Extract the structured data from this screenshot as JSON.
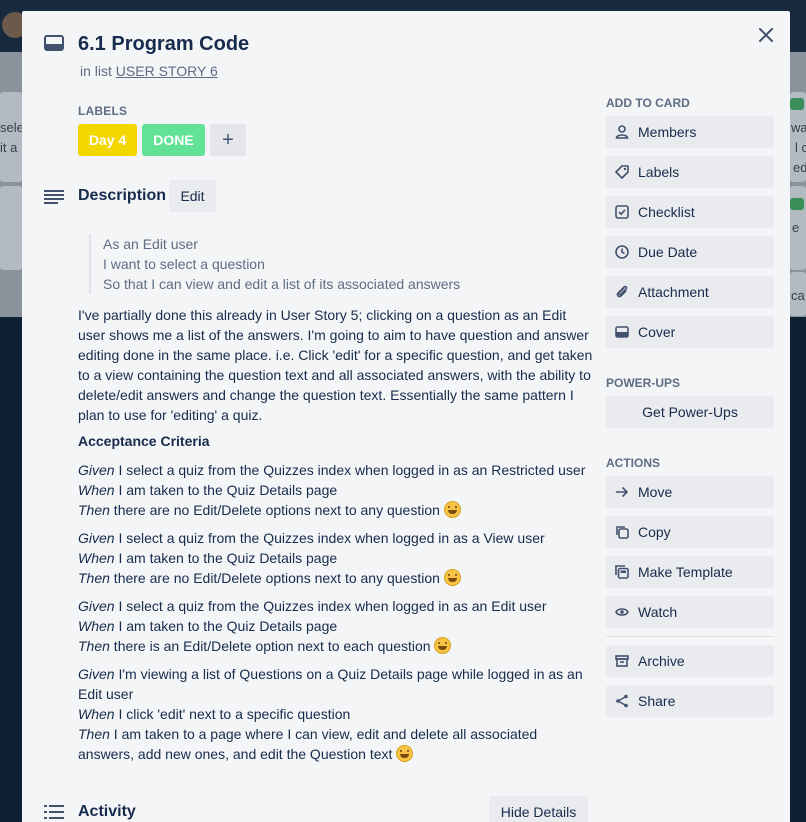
{
  "card": {
    "title": "6.1 Program Code",
    "in_list_prefix": "in list",
    "list_name": "USER STORY 6"
  },
  "labels": {
    "heading": "LABELS",
    "items": [
      {
        "text": "Day 4",
        "color": "#f2d600"
      },
      {
        "text": "DONE",
        "color": "#61bd4f"
      }
    ],
    "add_symbol": "+"
  },
  "description": {
    "heading": "Description",
    "edit_label": "Edit",
    "quote": [
      "As an Edit user",
      "I want to select a question",
      "So that I can view and edit a list of its associated answers"
    ],
    "body": "I've partially done this already in User Story 5; clicking on a question as an Edit user shows me a list of the answers. I'm going to aim to have question and answer editing done in the same place. i.e. Click 'edit' for a specific question, and get taken to a view containing the question text and all associated answers, with the ability to delete/edit answers and change the question text. Essentially the same pattern I plan to use for 'editing' a quiz.",
    "criteria_heading": "Acceptance Criteria",
    "criteria": [
      {
        "given": "Given",
        "given_text": " I select a quiz from the Quizzes index when logged in as an Restricted user",
        "when": "When",
        "when_text": " I am taken to the Quiz Details page",
        "then": "Then",
        "then_text": " there are no Edit/Delete options next to any question "
      },
      {
        "given": "Given",
        "given_text": " I select a quiz from the Quizzes index when logged in as a View user",
        "when": "When",
        "when_text": " I am taken to the Quiz Details page",
        "then": "Then",
        "then_text": " there are no Edit/Delete options next to any question "
      },
      {
        "given": "Given",
        "given_text": " I select a quiz from the Quizzes index when logged in as an Edit user",
        "when": "When",
        "when_text": " I am taken to the Quiz Details page",
        "then": "Then",
        "then_text": " there is an Edit/Delete option next to each question "
      },
      {
        "given": "Given",
        "given_text": " I'm viewing a list of Questions on a Quiz Details page while logged in as an Edit user",
        "when": "When",
        "when_text": " I click 'edit' next to a specific question",
        "then": "Then",
        "then_text": " I am taken to a page where I can view, edit and delete all associated answers, add new ones, and edit the Question text "
      }
    ]
  },
  "activity": {
    "heading": "Activity",
    "hide_details_label": "Hide Details"
  },
  "sidebar": {
    "add_to_card_heading": "ADD TO CARD",
    "add_to_card": [
      {
        "label": "Members",
        "icon": "person-icon"
      },
      {
        "label": "Labels",
        "icon": "tag-icon"
      },
      {
        "label": "Checklist",
        "icon": "checklist-icon"
      },
      {
        "label": "Due Date",
        "icon": "clock-icon"
      },
      {
        "label": "Attachment",
        "icon": "paperclip-icon"
      },
      {
        "label": "Cover",
        "icon": "cover-icon"
      }
    ],
    "power_ups_heading": "POWER-UPS",
    "get_power_ups_label": "Get Power-Ups",
    "actions_heading": "ACTIONS",
    "actions": [
      {
        "label": "Move",
        "icon": "arrow-right-icon"
      },
      {
        "label": "Copy",
        "icon": "copy-icon"
      },
      {
        "label": "Make Template",
        "icon": "template-icon"
      },
      {
        "label": "Watch",
        "icon": "eye-icon"
      }
    ],
    "actions_secondary": [
      {
        "label": "Archive",
        "icon": "archive-icon"
      },
      {
        "label": "Share",
        "icon": "share-icon"
      }
    ]
  },
  "background": {
    "snippets": [
      "sele",
      "it a",
      "wa",
      "l c",
      "ed",
      "e",
      "ca"
    ]
  }
}
